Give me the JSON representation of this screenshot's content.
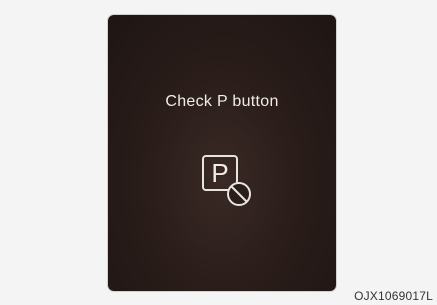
{
  "display": {
    "message": "Check P button",
    "icon": "p-button-prohibited-icon",
    "icon_letter": "P"
  },
  "caption": {
    "code": "OJX1069017L"
  },
  "colors": {
    "display_background": "#2a1d1a",
    "text": "#f0ece8",
    "icon_stroke": "#e8e4e0"
  }
}
